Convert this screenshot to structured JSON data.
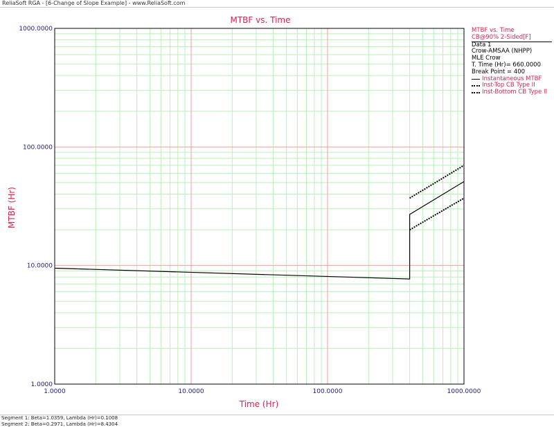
{
  "window": {
    "title": "ReliaSoft RGA - [6-Change of Slope Example] - www.ReliaSoft.com"
  },
  "legend": {
    "title": "MTBF vs. Time",
    "subtitle": "CB@90% 2-Sided[F]",
    "data_name": "Data 1",
    "model": "Crow-AMSAA (NHPP)",
    "method": "MLE Crow",
    "total_time": "T. Time (Hr)= 660.0000",
    "break_point": "Break Point = 400",
    "items": [
      {
        "label": "Instantaneous MTBF",
        "style": "solid"
      },
      {
        "label": "Inst-Top CB Type II",
        "style": "dotted"
      },
      {
        "label": "Inst-Bottom CB Type II",
        "style": "dotted"
      }
    ]
  },
  "footer": {
    "line1": "Segment 1: Beta=1.0359, Lambda (Hr)=0.1008",
    "line2": "Segment 2: Beta=0.2971, Lambda (Hr)=8.4304"
  },
  "colors": {
    "accent": "#e0204c",
    "tick_text": "#1a1a8c",
    "major_grid": "#ff9a9a",
    "minor_grid": "#b8f0b8"
  },
  "chart_data": {
    "type": "line",
    "title": "MTBF vs. Time",
    "xlabel": "Time (Hr)",
    "ylabel": "MTBF (Hr)",
    "x_scale": "log",
    "y_scale": "log",
    "xlim": [
      1,
      1000
    ],
    "ylim": [
      1,
      1000
    ],
    "x_ticks": [
      {
        "value": 1,
        "label": "1.0000"
      },
      {
        "value": 10,
        "label": "10.0000"
      },
      {
        "value": 100,
        "label": "100.0000"
      },
      {
        "value": 1000,
        "label": "1000.0000"
      }
    ],
    "y_ticks": [
      {
        "value": 1,
        "label": "1.0000"
      },
      {
        "value": 10,
        "label": "10.0000"
      },
      {
        "value": 100,
        "label": "100.0000"
      },
      {
        "value": 1000,
        "label": "1000.0000"
      }
    ],
    "grid": true,
    "legend_position": "right",
    "series": [
      {
        "name": "Instantaneous MTBF",
        "style": "solid",
        "x": [
          1,
          400,
          400,
          1000
        ],
        "y": [
          9.5,
          7.7,
          27,
          51
        ]
      },
      {
        "name": "Inst-Top CB Type II",
        "style": "dotted",
        "x": [
          400,
          1000
        ],
        "y": [
          37,
          70
        ]
      },
      {
        "name": "Inst-Bottom CB Type II",
        "style": "dotted",
        "x": [
          400,
          1000
        ],
        "y": [
          20,
          37
        ]
      }
    ]
  }
}
